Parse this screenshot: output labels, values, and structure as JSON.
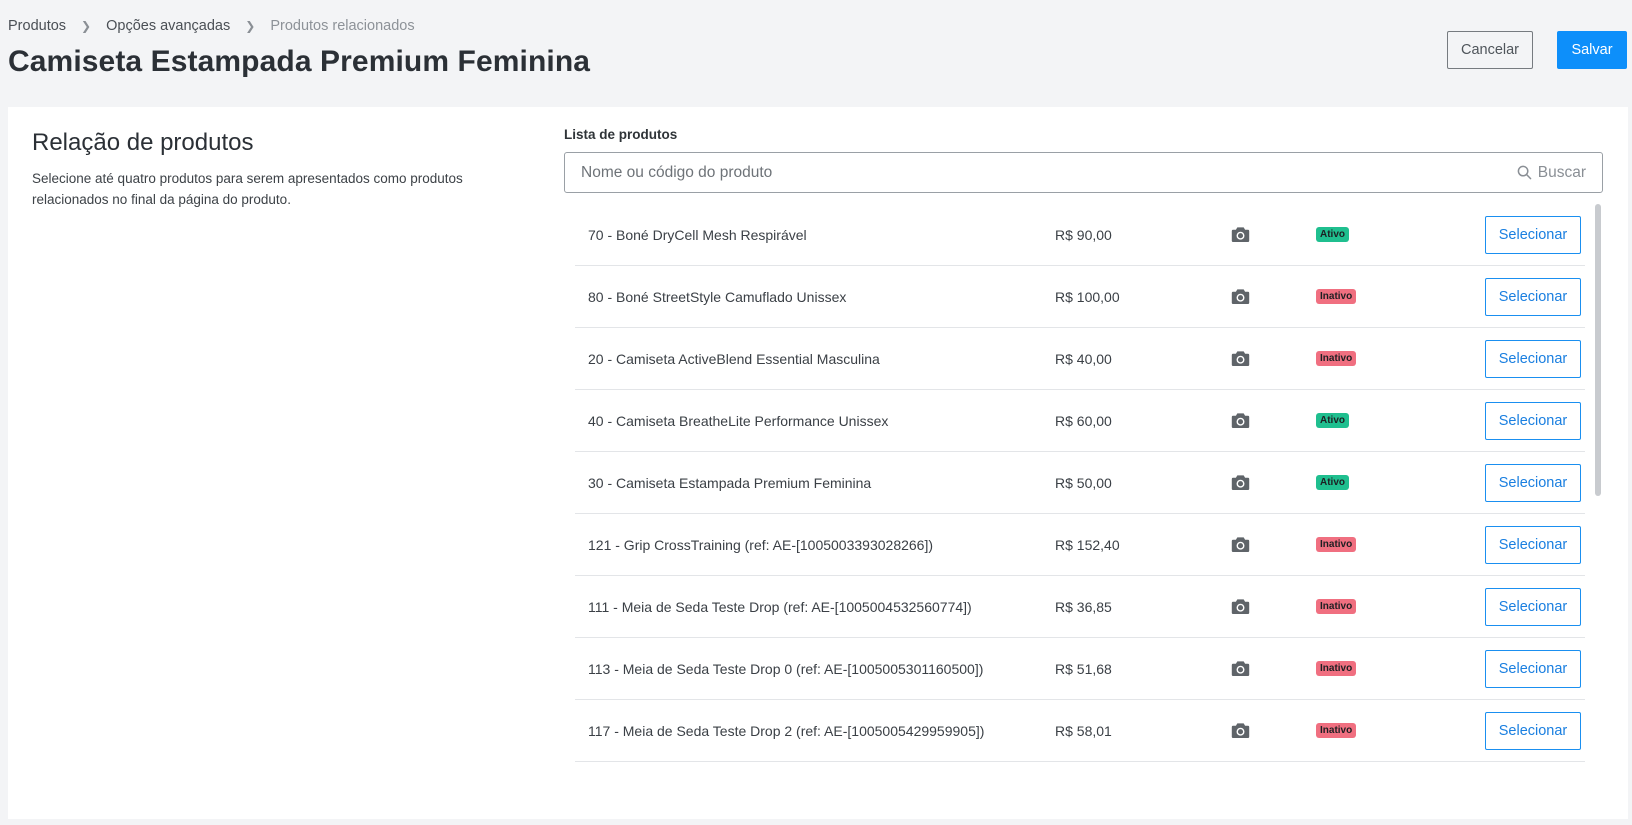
{
  "breadcrumb": [
    {
      "label": "Produtos"
    },
    {
      "label": "Opções avançadas"
    },
    {
      "label": "Produtos relacionados"
    }
  ],
  "page_title": "Camiseta Estampada Premium Feminina",
  "actions": {
    "cancel_label": "Cancelar",
    "save_label": "Salvar"
  },
  "section": {
    "title": "Relação de produtos",
    "description": "Selecione até quatro produtos para serem apresentados como produtos relacionados no final da página do produto."
  },
  "product_list": {
    "label": "Lista de produtos",
    "search_placeholder": "Nome ou código do produto",
    "search_button": "Buscar",
    "select_label": "Selecionar",
    "items": [
      {
        "name": "70 - Boné DryCell Mesh Respirável",
        "price": "R$ 90,00",
        "status": "Ativo"
      },
      {
        "name": "80 - Boné StreetStyle Camuflado Unissex",
        "price": "R$ 100,00",
        "status": "Inativo"
      },
      {
        "name": "20 - Camiseta ActiveBlend Essential Masculina",
        "price": "R$ 40,00",
        "status": "Inativo"
      },
      {
        "name": "40 - Camiseta BreatheLite Performance Unissex",
        "price": "R$ 60,00",
        "status": "Ativo"
      },
      {
        "name": "30 - Camiseta Estampada Premium Feminina",
        "price": "R$ 50,00",
        "status": "Ativo"
      },
      {
        "name": "121 - Grip CrossTraining (ref: AE-[1005003393028266])",
        "price": "R$ 152,40",
        "status": "Inativo"
      },
      {
        "name": "111 - Meia de Seda Teste Drop (ref: AE-[1005004532560774])",
        "price": "R$ 36,85",
        "status": "Inativo"
      },
      {
        "name": "113 - Meia de Seda Teste Drop 0 (ref: AE-[1005005301160500])",
        "price": "R$ 51,68",
        "status": "Inativo"
      },
      {
        "name": "117 - Meia de Seda Teste Drop 2 (ref: AE-[1005005429959905])",
        "price": "R$ 58,01",
        "status": "Inativo"
      }
    ]
  },
  "icons": {
    "search": "search-icon",
    "photo": "camera-icon",
    "breadcrumb_separator": "chevron-right-icon"
  },
  "colors": {
    "primary": "#0d8ffa",
    "active_badge": "#1fbf8f",
    "inactive_badge": "#f06f80"
  }
}
